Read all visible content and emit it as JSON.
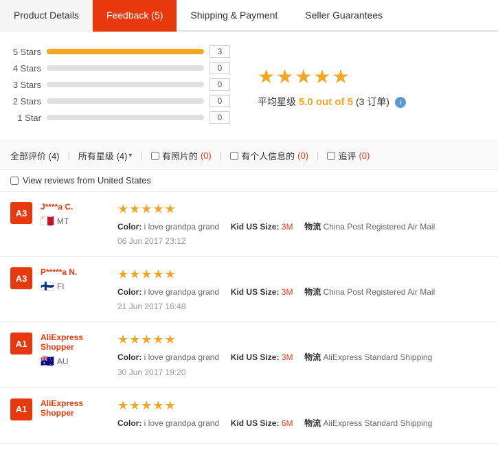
{
  "tabs": [
    {
      "id": "product-details",
      "label": "Product Details",
      "active": false
    },
    {
      "id": "feedback",
      "label": "Feedback (5)",
      "active": true
    },
    {
      "id": "shipping-payment",
      "label": "Shipping & Payment",
      "active": false
    },
    {
      "id": "seller-guarantees",
      "label": "Seller Guarantees",
      "active": false
    }
  ],
  "rating": {
    "stars": [
      {
        "label": "5 Stars",
        "count": 3,
        "pct": 100
      },
      {
        "label": "4 Stars",
        "count": 0,
        "pct": 0
      },
      {
        "label": "3 Stars",
        "count": 0,
        "pct": 0
      },
      {
        "label": "2 Stars",
        "count": 0,
        "pct": 0
      },
      {
        "label": "1 Star",
        "count": 0,
        "pct": 0
      }
    ],
    "average": "5.0",
    "average_label": "5.0 out of 5",
    "total_label": "(3 订单)",
    "avg_prefix": "平均星级"
  },
  "filters": {
    "all_label": "全部评价 (4)",
    "all_star_label": "所有星级 (4)",
    "photo_label": "有照片的",
    "photo_count": "(0)",
    "personal_label": "有个人信息的",
    "personal_count": "(0)",
    "followup_label": "追评",
    "followup_count": "(0)"
  },
  "country_filter": {
    "label": "View reviews from United States"
  },
  "reviews": [
    {
      "avatar_text": "A3",
      "avatar_class": "avatar-a3",
      "name": "J****a C.",
      "country_flag": "🇲🇹",
      "country_code": "MT",
      "stars": 5,
      "color_label": "Color:",
      "color_value": "i love grandpa grand",
      "size_label": "Kid US Size:",
      "size_value": "3M",
      "logistics_label": "物流",
      "logistics_value": "China Post Registered Air Mail",
      "date": "06 Jun 2017 23:12"
    },
    {
      "avatar_text": "A3",
      "avatar_class": "avatar-a3",
      "name": "P*****a N.",
      "country_flag": "🇫🇮",
      "country_code": "FI",
      "stars": 5,
      "color_label": "Color:",
      "color_value": "i love grandpa grand",
      "size_label": "Kid US Size:",
      "size_value": "3M",
      "logistics_label": "物流",
      "logistics_value": "China Post Registered Air Mail",
      "date": "21 Jun 2017 16:48"
    },
    {
      "avatar_text": "A1",
      "avatar_class": "avatar-a1",
      "name": "AliExpress Shopper",
      "country_flag": "🇦🇺",
      "country_code": "AU",
      "stars": 5,
      "color_label": "Color:",
      "color_value": "i love grandpa grand",
      "size_label": "Kid US Size:",
      "size_value": "3M",
      "logistics_label": "物流",
      "logistics_value": "AliExpress Standard Shipping",
      "date": "30 Jun 2017 19:20"
    },
    {
      "avatar_text": "A1",
      "avatar_class": "avatar-a1",
      "name": "AliExpress Shopper",
      "country_flag": "",
      "country_code": "",
      "stars": 5,
      "color_label": "Color:",
      "color_value": "i love grandpa grand",
      "size_label": "Kid US Size:",
      "size_value": "6M",
      "logistics_label": "物流",
      "logistics_value": "AliExpress Standard Shipping",
      "date": ""
    }
  ]
}
